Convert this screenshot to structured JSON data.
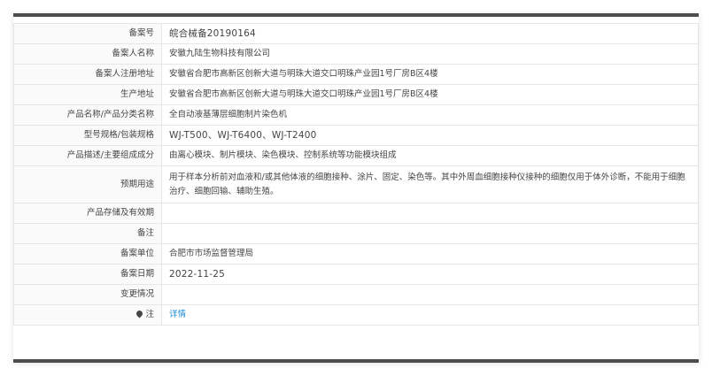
{
  "rows": [
    {
      "label": "备案号",
      "value": "皖合械备20190164"
    },
    {
      "label": "备案人名称",
      "value": "安徽九陆生物科技有限公司"
    },
    {
      "label": "备案人注册地址",
      "value": "安徽省合肥市高新区创新大道与明珠大道交口明珠产业园1号厂房B区4楼"
    },
    {
      "label": "生产地址",
      "value": "安徽省合肥市高新区创新大道与明珠大道交口明珠产业园1号厂房B区4楼"
    },
    {
      "label": "产品名称/产品分类名称",
      "value": "全自动液基薄层细胞制片染色机"
    },
    {
      "label": "型号规格/包装规格",
      "value": "WJ-T500、WJ-T6400、WJ-T2400"
    },
    {
      "label": "产品描述/主要组成成分",
      "value": "由离心模块、制片模块、染色模块、控制系统等功能模块组成"
    },
    {
      "label": "预期用途",
      "value": "用于样本分析前对血液和/或其他体液的细胞接种、涂片、固定、染色等。其中外周血细胞接种仪接种的细胞仅用于体外诊断，不能用于细胞治疗、细胞回输、辅助生殖。"
    },
    {
      "label": "产品存储及有效期",
      "value": ""
    },
    {
      "label": "备注",
      "value": ""
    },
    {
      "label": "备案单位",
      "value": "合肥市市场监督管理局"
    },
    {
      "label": "备案日期",
      "value": "2022-11-25"
    },
    {
      "label": "变更情况",
      "value": ""
    },
    {
      "label": "注",
      "value": "详情"
    }
  ],
  "icons": {
    "note": "pin-icon"
  },
  "colors": {
    "link": "#1a8cd8",
    "bar": "#4d4d4d",
    "border": "#e6e6e6"
  }
}
